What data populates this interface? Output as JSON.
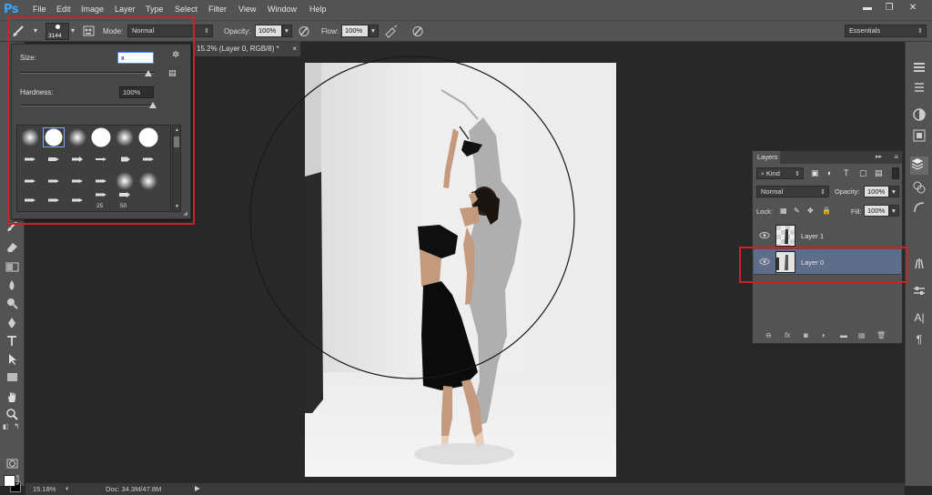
{
  "app": {
    "logo": "Ps"
  },
  "menu": [
    "File",
    "Edit",
    "Image",
    "Layer",
    "Type",
    "Select",
    "Filter",
    "View",
    "Window",
    "Help"
  ],
  "window_controls": {
    "minimize": "▬",
    "restore": "❐",
    "close": "✕"
  },
  "options_bar": {
    "brush_size": "3144",
    "mode_label": "Mode:",
    "mode_value": "Normal",
    "opacity_label": "Opacity:",
    "opacity_value": "100%",
    "flow_label": "Flow:",
    "flow_value": "100%",
    "workspace": "Essentials"
  },
  "document": {
    "tab_title": "15.2% (Layer 0, RGB/8) *",
    "zoom": "15.18%",
    "doc_info": "Doc: 34.3M/47.8M"
  },
  "brush_popup": {
    "size_label": "Size:",
    "size_value": "x",
    "hardness_label": "Hardness:",
    "hardness_value": "100%",
    "hardness_fraction": 1.0,
    "size_fraction": 0.98,
    "brush_numbers": [
      "25",
      "50"
    ]
  },
  "layers_panel": {
    "tab": "Layers",
    "filter_kind": "Kind",
    "blend_mode": "Normal",
    "opacity_label": "Opacity:",
    "opacity_value": "100%",
    "lock_label": "Lock:",
    "fill_label": "Fill:",
    "fill_value": "100%",
    "layers": [
      {
        "name": "Layer 1",
        "selected": false
      },
      {
        "name": "Layer 0",
        "selected": true
      }
    ]
  },
  "colors": {
    "highlight": "#c8222b",
    "selected_layer": "#5e6d8a",
    "foreground": "#ffffff",
    "background": "#000000"
  }
}
